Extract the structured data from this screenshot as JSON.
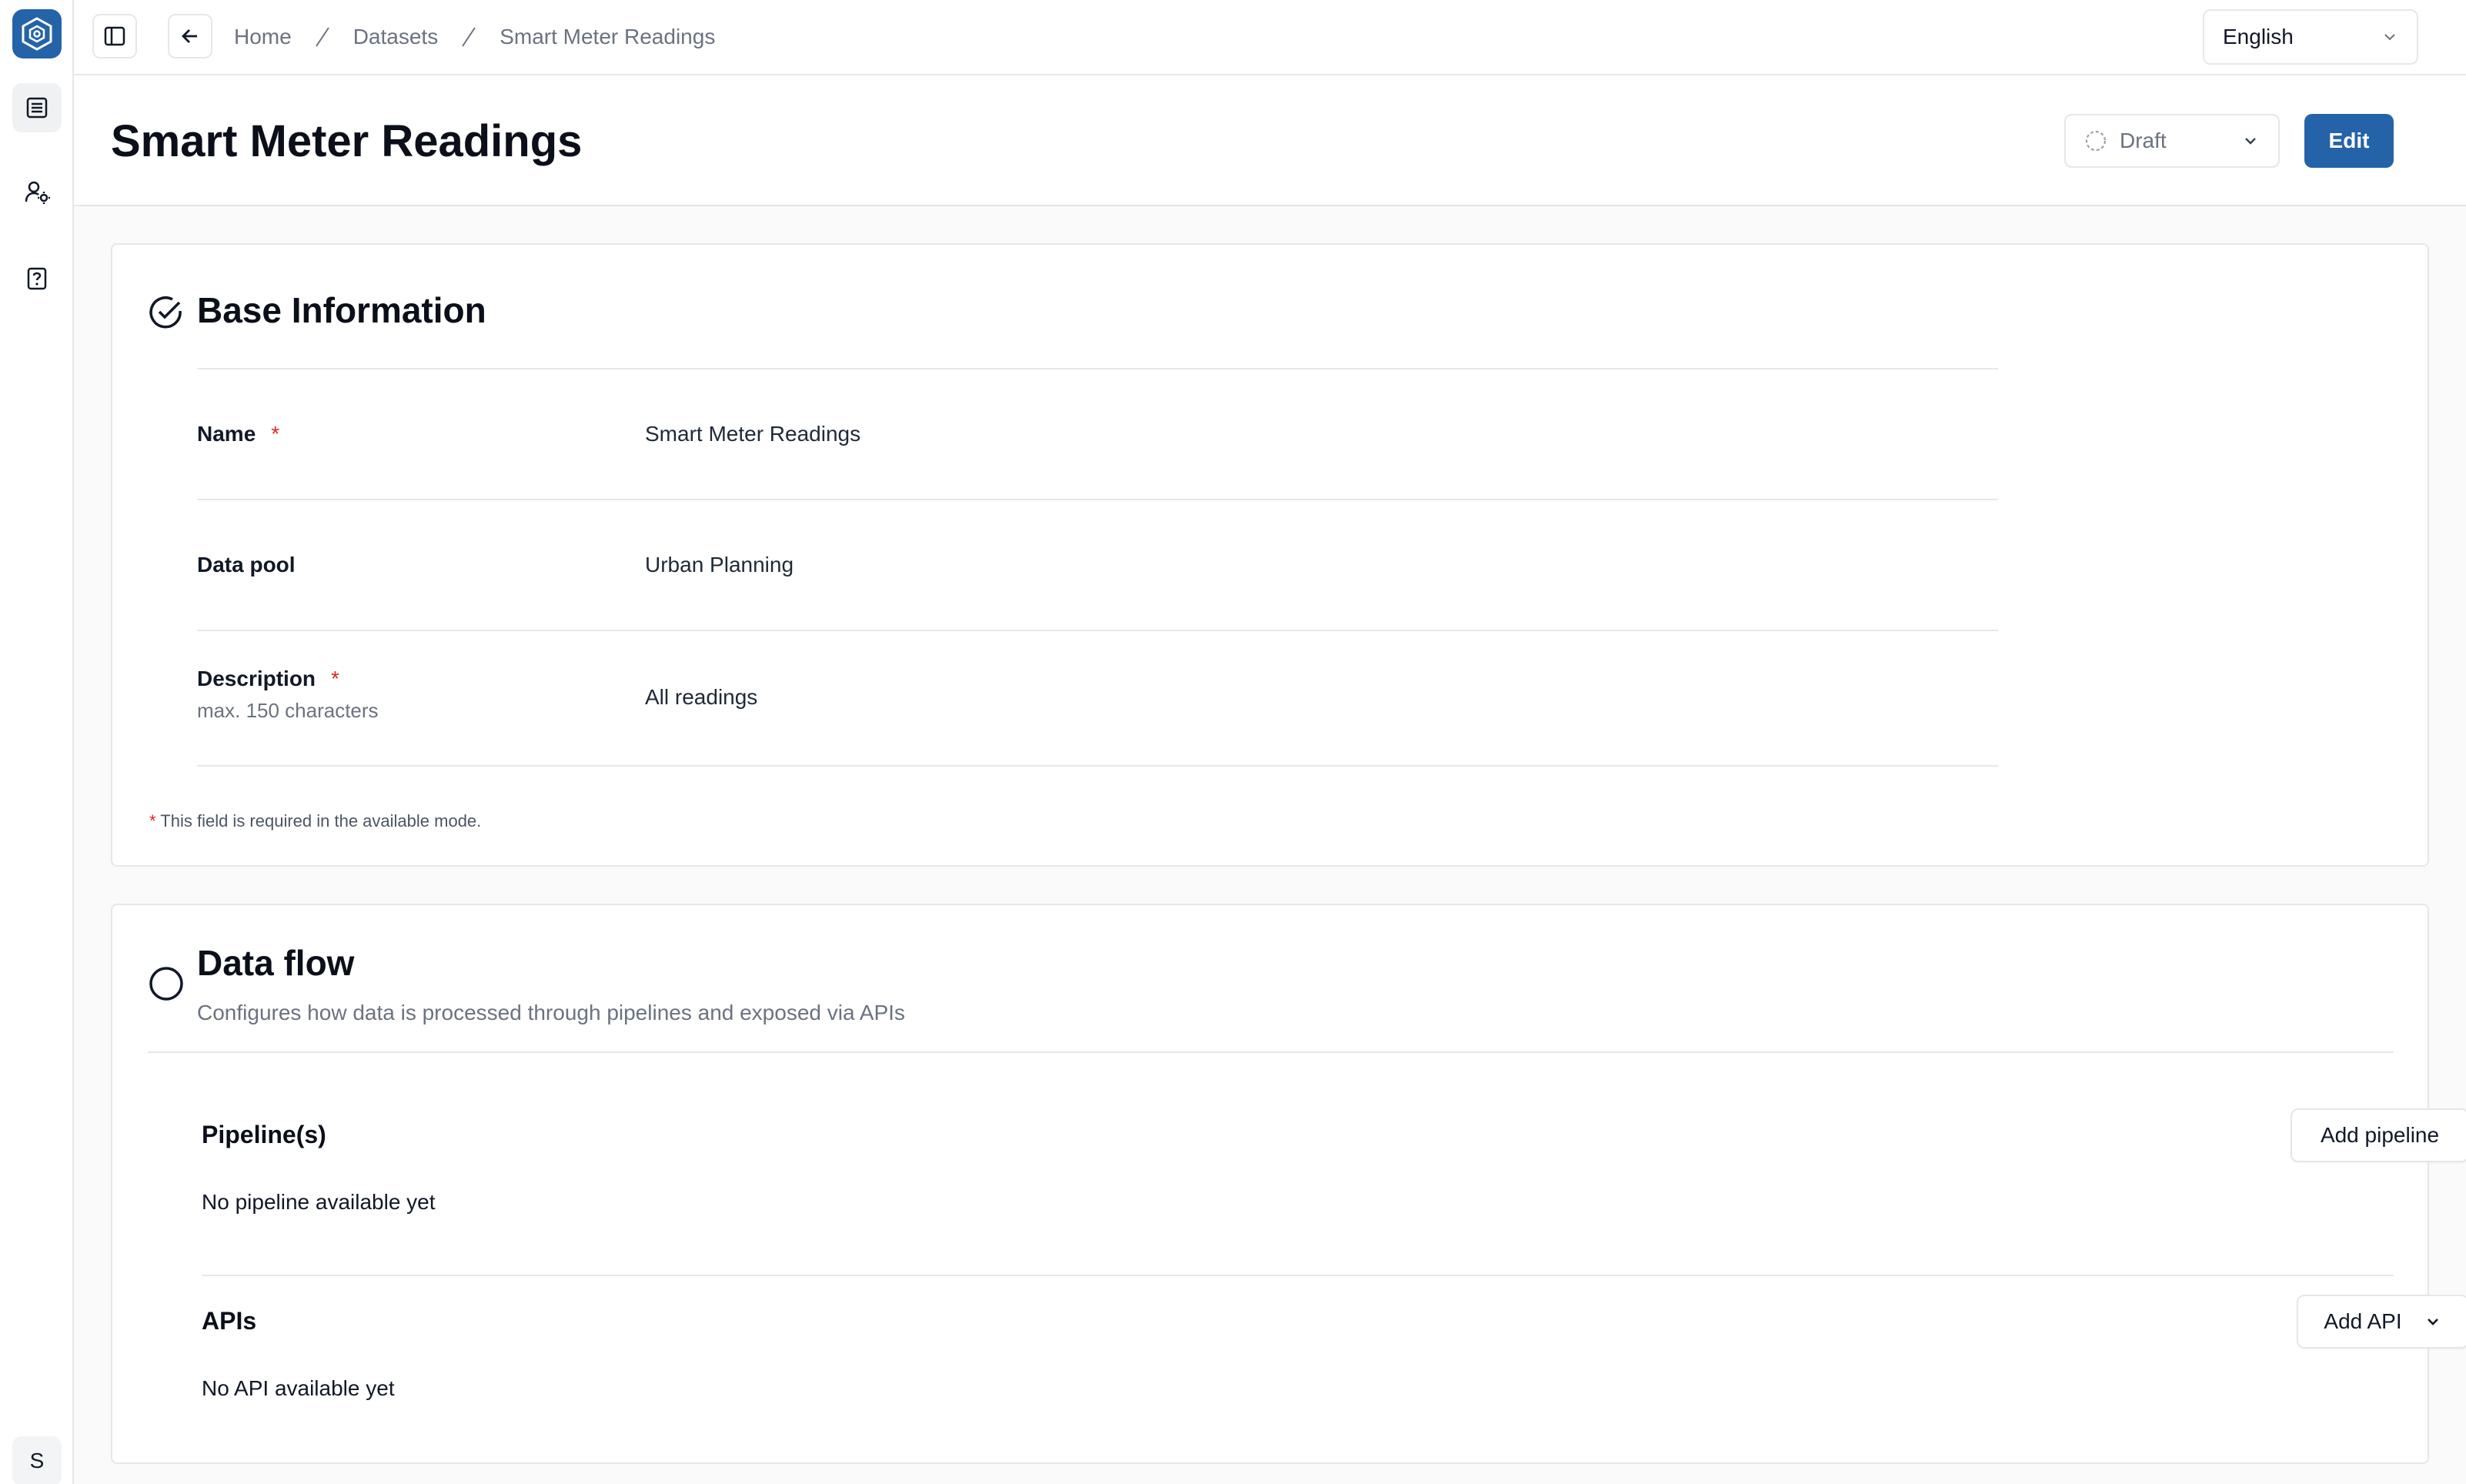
{
  "app": {
    "avatar_initial": "S"
  },
  "breadcrumb": [
    "Home",
    "Datasets",
    "Smart Meter Readings"
  ],
  "language": {
    "selected": "English"
  },
  "header": {
    "title": "Smart Meter Readings",
    "status": "Draft",
    "edit_label": "Edit"
  },
  "base_info": {
    "title": "Base Information",
    "fields": {
      "name": {
        "label": "Name",
        "required_mark": "*",
        "value": "Smart Meter Readings"
      },
      "data_pool": {
        "label": "Data pool",
        "value": "Urban Planning"
      },
      "description": {
        "label": "Description",
        "required_mark": "*",
        "hint": "max. 150 characters",
        "value": "All readings"
      }
    },
    "footnote_star": "*",
    "footnote": "This field is required in the available mode."
  },
  "data_flow": {
    "title": "Data flow",
    "subtitle": "Configures how data is processed through pipelines and exposed via APIs",
    "pipelines": {
      "heading": "Pipeline(s)",
      "empty": "No pipeline available yet",
      "add_label": "Add pipeline"
    },
    "apis": {
      "heading": "APIs",
      "empty": "No API available yet",
      "add_label": "Add API"
    }
  },
  "icons": {
    "logo": "hexagon-logo-icon",
    "sidebar": [
      "list-icon",
      "user-settings-icon",
      "help-document-icon"
    ],
    "toolbar": [
      "sidebar-toggle-icon",
      "arrow-left-icon"
    ]
  },
  "colors": {
    "accent": "#2563a8",
    "required": "#dc2626",
    "border": "#e5e7eb"
  }
}
